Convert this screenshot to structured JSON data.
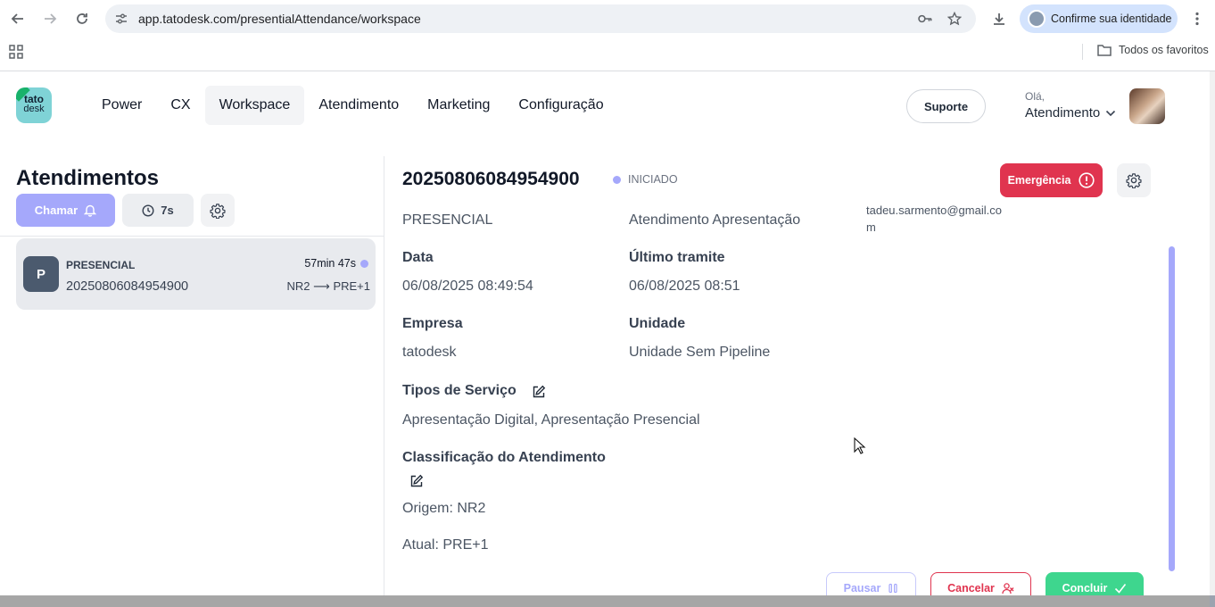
{
  "browser": {
    "url": "app.tatodesk.com/presentialAttendance/workspace",
    "profile_label": "Confirme sua identidade",
    "bookmarks_label": "Todos os favoritos"
  },
  "header": {
    "logo_top": "tato",
    "logo_bottom": "desk",
    "menu": [
      "Power",
      "CX",
      "Workspace",
      "Atendimento",
      "Marketing",
      "Configuração"
    ],
    "active_menu": "Workspace",
    "support_label": "Suporte",
    "greeting": "Olá,",
    "user_role": "Atendimento"
  },
  "sidebar": {
    "title": "Atendimentos",
    "call_label": "Chamar",
    "timer_label": "7s",
    "queue": [
      {
        "avatar": "P",
        "type": "PRESENCIAL",
        "protocol": "20250806084954900",
        "elapsed": "57min 47s",
        "route_from": "NR2",
        "route_arrow": "⟶",
        "route_to": "PRE+1"
      }
    ]
  },
  "main": {
    "protocol": "20250806084954900",
    "status": "INICIADO",
    "emergency_label": "Emergência",
    "fields": {
      "type_value": "PRESENCIAL",
      "service_value": "Atendimento Apresentação",
      "email_value": "tadeu.sarmento@gmail.com",
      "date_label": "Data",
      "date_value": "06/08/2025 08:49:54",
      "last_label": "Último tramite",
      "last_value": "06/08/2025 08:51",
      "company_label": "Empresa",
      "company_value": "tatodesk",
      "unit_label": "Unidade",
      "unit_value": "Unidade Sem Pipeline",
      "services_label": "Tipos de Serviço",
      "services_value": "Apresentação Digital, Apresentação Presencial",
      "classification_label": "Classificação do Atendimento",
      "origin_value": "Origem: NR2",
      "current_value": "Atual: PRE+1"
    },
    "actions": {
      "pause_label": "Pausar",
      "cancel_label": "Cancelar",
      "conclude_label": "Concluir"
    }
  },
  "colors": {
    "accent": "#a5a8fb",
    "danger": "#e0344f",
    "success": "#3ed68e"
  }
}
